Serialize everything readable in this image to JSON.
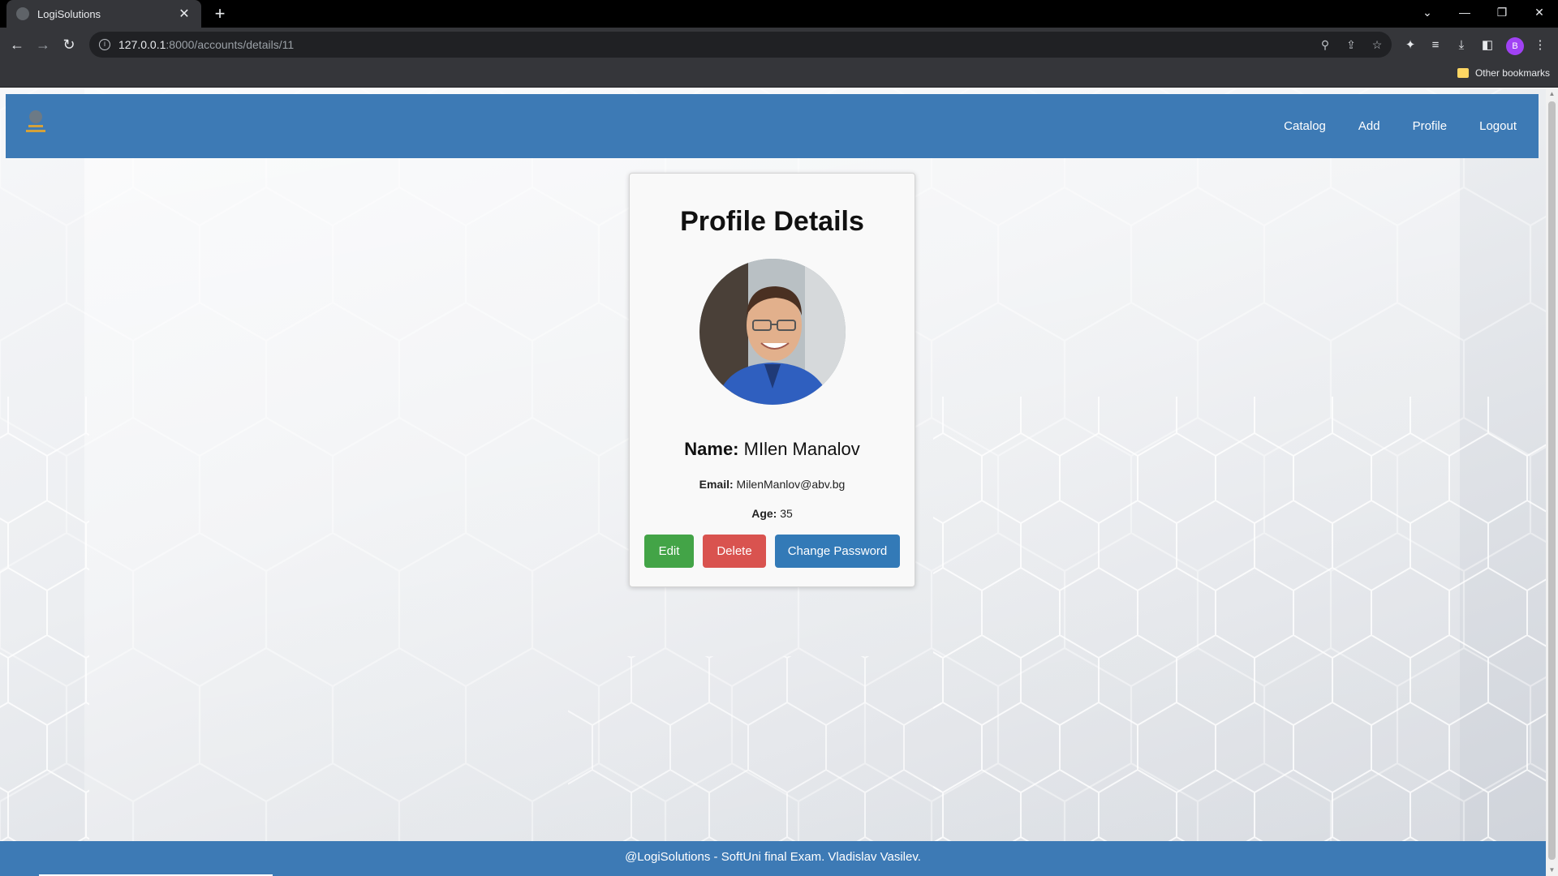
{
  "browser": {
    "tab_title": "LogiSolutions",
    "tab_close": "✕",
    "new_tab": "+",
    "url_host": "127.0.0.1",
    "url_rest": ":8000/accounts/details/11",
    "bookmark_folder": "Other bookmarks",
    "profile_initial": "B"
  },
  "nav": {
    "links": [
      "Catalog",
      "Add",
      "Profile",
      "Logout"
    ]
  },
  "profile": {
    "title": "Profile Details",
    "name_label": "Name:",
    "name_value": "MIlen Manalov",
    "email_label": "Email:",
    "email_value": "MilenManlov@abv.bg",
    "age_label": "Age:",
    "age_value": "35"
  },
  "buttons": {
    "edit": "Edit",
    "delete": "Delete",
    "change_password": "Change Password"
  },
  "footer": {
    "text": "@LogiSolutions - SoftUni final Exam. Vladislav Vasilev."
  },
  "colors": {
    "nav_blue": "#3d7ab5",
    "edit_green": "#43a447",
    "delete_red": "#d9534f",
    "password_blue": "#337ab7"
  }
}
